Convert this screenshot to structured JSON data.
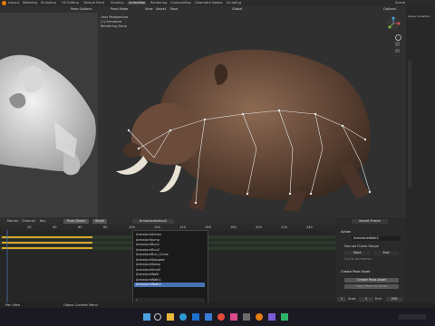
{
  "menu": {
    "tabs": [
      "Layout",
      "Modeling",
      "Sculpting",
      "UV Editing",
      "Texture Paint",
      "Shading",
      "Animation",
      "Rendering",
      "Compositing",
      "Geometry Nodes",
      "Scripting"
    ],
    "active_tab": "Animation",
    "scene_label": "Scene"
  },
  "left_viewport": {
    "mode_label": "Pose Options"
  },
  "viewport": {
    "mode": "Pose Mode",
    "menus": [
      "View",
      "Select",
      "Pose"
    ],
    "transform_label": "Global",
    "options_label": "Options",
    "overlay_line1": "User Perspective",
    "overlay_line2": "(1) Armature",
    "overlay_line3": "Rendering Done"
  },
  "timeline": {
    "menus": [
      "Marker",
      "Channel",
      "Key"
    ],
    "push_down_label": "Push Down",
    "stash_label": "Stash",
    "action_name": "ArmatureAction2",
    "frame_ticks": [
      "20",
      "40",
      "60",
      "80",
      "100",
      "120",
      "140",
      "160",
      "180",
      "200",
      "220",
      "240"
    ]
  },
  "dropdown": {
    "items": [
      "ArmatureAction",
      "ArmatureJump",
      "ArmatureRun1",
      "ArmatureRun2",
      "ArmatureRun_Circle",
      "ArmatureSlapped",
      "ArmatureSleep",
      "ArmatureSmell",
      "ArmatureWalk",
      "ArmatureWalk1",
      "ArmatureWalk2"
    ],
    "selected_index": 10,
    "search_placeholder": "⌕"
  },
  "properties": {
    "keyed_frame_label": "Keyed Frame",
    "action_header": "Action",
    "action_value": "ArmatureWalk2",
    "manual_frame_range": "Manual Frame Range",
    "start_label": "Start",
    "end_label": "End",
    "cyclic_label": "Cyclic Animation",
    "pose_asset_header": "Create Pose Asset",
    "create_pose_asset_button": "Create Pose Asset",
    "copy_pose_button": "Copy Pose as Asset"
  },
  "footer": {
    "frame_start": "1",
    "frame_end": "250",
    "current_frame": "1",
    "start_label": "Start",
    "end_label": "End"
  },
  "status": {
    "text": "Pan View",
    "context_menu": "Object Context Menu"
  },
  "outliner": {
    "scene_collection": "Scene Collection"
  },
  "colors": {
    "accent": "#4772b3",
    "keyframe": "#d9a62a",
    "bone_line": "#e6e6e6"
  }
}
